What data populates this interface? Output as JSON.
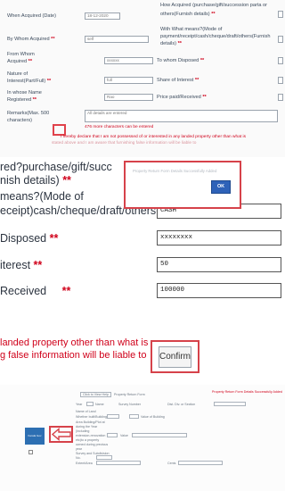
{
  "form_top": {
    "acquired_when_label": "When Acquired (Date)",
    "acquired_when_value": "18-12-2020",
    "how_acquired_text_1": "How Acquired (purchase/gift/succession parta or",
    "how_acquired_text_2": "others(Furnish details)",
    "acquired_by_label": "By Whom Acquired",
    "acquired_by_value": "self",
    "mode_text_1": "With What means?(Mode of",
    "mode_text_2": "payment/receipt/cash/cheque/draft/others(Furnish",
    "mode_text_3": "details)",
    "from_whom_label_1": "From Whom",
    "from_whom_label_2": "Acquired",
    "from_whom_value": "xxxxxx",
    "to_whom_label": "To whom Disposed",
    "nature_label_1": "Nature of",
    "nature_label_2": "Interest(Part/Full)",
    "nature_value": "full",
    "share_label": "Share of Interest",
    "name_label_1": "In whose Name",
    "name_label_2": "Registered",
    "name_value": "Rao",
    "price_label": "Price paid/Received",
    "remarks_label_1": "Remarks(Max. 500",
    "remarks_label_2": "characters)",
    "remarks_value": "All details are entered",
    "chars_hint": "476 more characters can be entered",
    "declaration_1": "I hereby declare that I am not possessed of or interested in any landed property other than what is",
    "declaration_2": "stated above and I am aware that furnishing false information will be liable to"
  },
  "form_zoom": {
    "row1": "red?purchase/gift/succ",
    "row2": "nish details)",
    "row3": "means?(Mode of",
    "row4": "eceipt)cash/cheque/draft/others(Furnish",
    "mode_value": "CASH",
    "disposed_label": "Disposed",
    "disposed_value": "xxxxxxxx",
    "interest_label": "iterest",
    "interest_value": "50",
    "received_label": "Received",
    "received_value": "100000",
    "decl_1": "landed property other than what is",
    "decl_2": "g false information will be liable to",
    "confirm_label": "Confirm",
    "dialog_message": "Property Return Form Details Successfully Added",
    "ok_label": "OK"
  },
  "form_bottom": {
    "link_1": "Click to View Help",
    "link_2": "Property Return Form",
    "heading_right": "Property Return Form Details Successfully Added",
    "col_year": "Year",
    "col_name": "Name",
    "col_survey": "Survey Number",
    "col_dist": "Dist. Div. or Section",
    "row_labels": [
      "Name of Land",
      "Whether built/Building",
      "Area Building/Plot at",
      "during the Year",
      "(including",
      "extension-renovation",
      "etc)to a property",
      "owned during previous",
      "year",
      "Survey and Subdivision",
      "No.",
      "Extent/Area"
    ],
    "value_of_building_label": "Value of Building",
    "value_label": "Value",
    "cents_label": "Cents",
    "logo_text": "Kerala Gov"
  },
  "colors": {
    "required": "#d0021b",
    "highlight": "#d6424a",
    "ok_button": "#2e62b8"
  }
}
